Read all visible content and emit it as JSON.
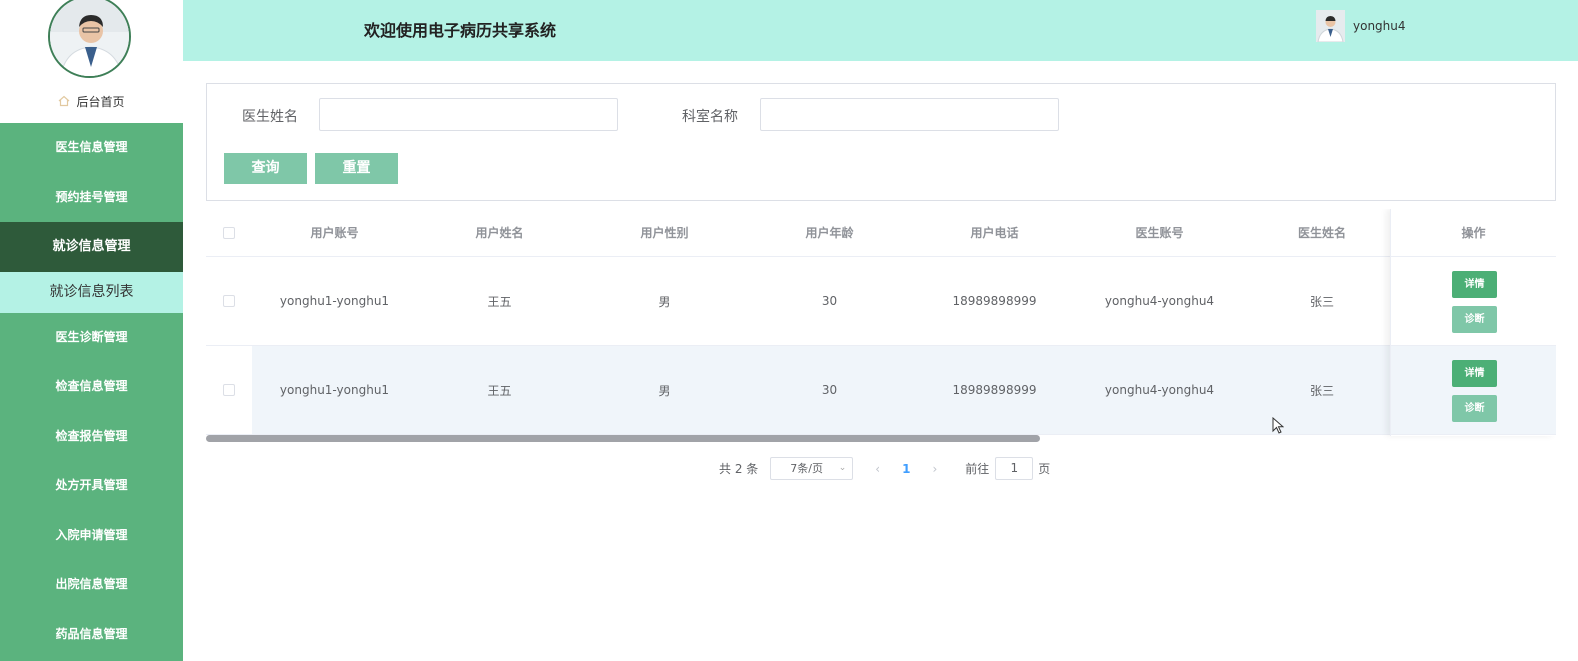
{
  "header": {
    "title": "欢迎使用电子病历共享系统",
    "username": "yonghu4"
  },
  "sidebar": {
    "home_label": "后台首页",
    "items": [
      {
        "label": "医生信息管理",
        "active": false
      },
      {
        "label": "预约挂号管理",
        "active": false
      },
      {
        "label": "就诊信息管理",
        "active": true
      },
      {
        "label": "医生诊断管理",
        "active": false
      },
      {
        "label": "检查信息管理",
        "active": false
      },
      {
        "label": "检查报告管理",
        "active": false
      },
      {
        "label": "处方开具管理",
        "active": false
      },
      {
        "label": "入院申请管理",
        "active": false
      },
      {
        "label": "出院信息管理",
        "active": false
      },
      {
        "label": "药品信息管理",
        "active": false
      }
    ],
    "submenu": {
      "label": "就诊信息列表"
    }
  },
  "search": {
    "doctor_name_label": "医生姓名",
    "doctor_name_value": "",
    "dept_name_label": "科室名称",
    "dept_name_value": "",
    "query_button": "查询",
    "reset_button": "重置"
  },
  "table": {
    "columns": [
      "用户账号",
      "用户姓名",
      "用户性别",
      "用户年龄",
      "用户电话",
      "医生账号",
      "医生姓名"
    ],
    "ops_header": "操作",
    "rows": [
      [
        "yonghu1-yonghu1",
        "王五",
        "男",
        "30",
        "18989898999",
        "yonghu4-yonghu4",
        "张三"
      ],
      [
        "yonghu1-yonghu1",
        "王五",
        "男",
        "30",
        "18989898999",
        "yonghu4-yonghu4",
        "张三"
      ]
    ],
    "detail_button": "详情",
    "diagnose_button": "诊断"
  },
  "pagination": {
    "total_text": "共 2 条",
    "page_size": "7条/页",
    "current_page": "1",
    "goto_label": "前往",
    "goto_value": "1",
    "page_suffix": "页"
  },
  "colors": {
    "sidebar_bg": "#5bb37e",
    "header_bg": "#b4f2e5",
    "active_menu": "#2e5a3a",
    "accent_button": "#4caf76"
  }
}
